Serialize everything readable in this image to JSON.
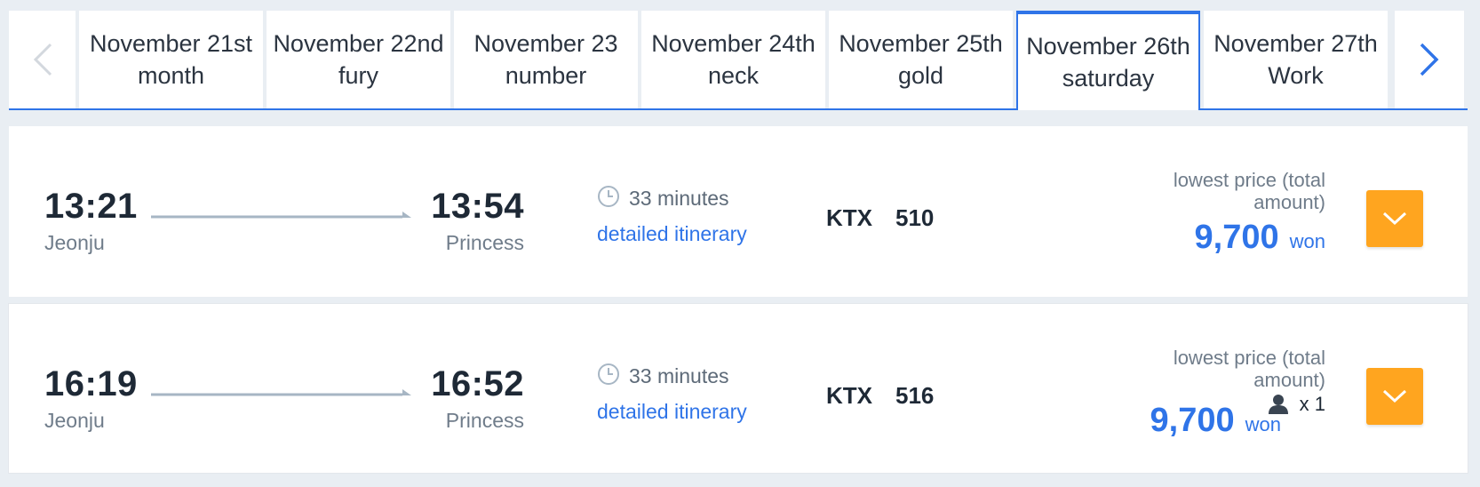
{
  "date_strip": {
    "dates": [
      {
        "line1": "November 21st",
        "line2": "month"
      },
      {
        "line1": "November 22nd",
        "line2": "fury"
      },
      {
        "line1": "November 23",
        "line2": "number"
      },
      {
        "line1": "November 24th",
        "line2": "neck"
      },
      {
        "line1": "November 25th",
        "line2": "gold"
      },
      {
        "line1": "November 26th",
        "line2": "saturday"
      },
      {
        "line1": "November 27th",
        "line2": "Work"
      }
    ],
    "selected": "November 26th"
  },
  "trains": [
    {
      "departure_time": "13:21",
      "departure_station": "Jeonju",
      "arrival_time": "13:54",
      "arrival_station": "Princess",
      "duration": "33 minutes",
      "itinerary_link": "detailed itinerary",
      "train_type": "KTX",
      "train_number": "510",
      "price_label": "lowest price (total amount)",
      "price": "9,700",
      "currency": "won"
    },
    {
      "departure_time": "16:19",
      "departure_station": "Jeonju",
      "arrival_time": "16:52",
      "arrival_station": "Princess",
      "duration": "33 minutes",
      "itinerary_link": "detailed itinerary",
      "train_type": "KTX",
      "train_number": "516",
      "price_label": "lowest price (total amount)",
      "passenger_count": "x 1",
      "price": "9,700",
      "currency": "won"
    }
  ],
  "colors": {
    "accent": "#2f74e8",
    "button": "#ffa51f",
    "text_dark": "#1e2936",
    "text_muted": "#6f7c8a",
    "background": "#e9eef3"
  },
  "icons": {
    "prev": "chevron-left-icon",
    "next": "chevron-right-icon",
    "duration": "clock-icon",
    "passenger": "person-icon",
    "expand": "chevron-down-icon"
  }
}
